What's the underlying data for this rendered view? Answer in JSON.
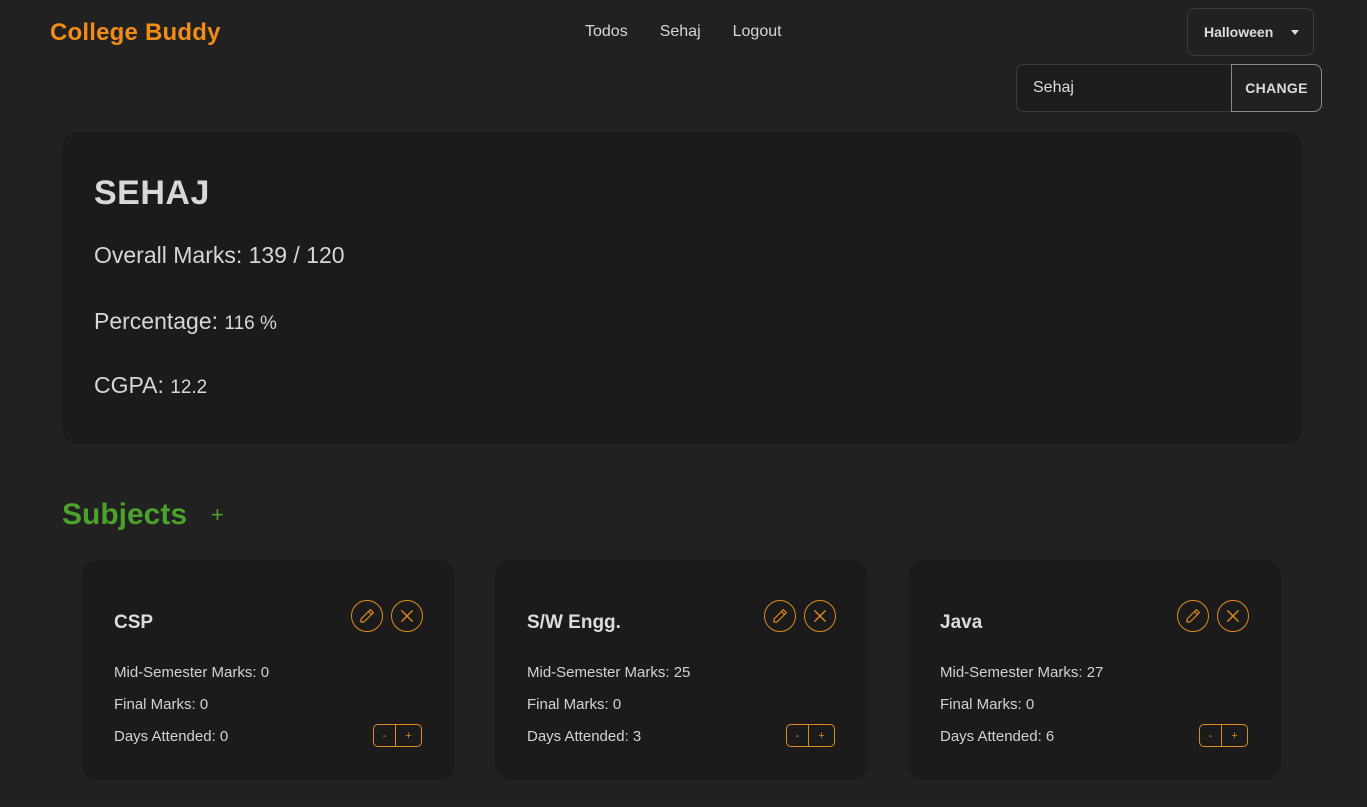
{
  "brand": "College Buddy",
  "nav": {
    "todos": "Todos",
    "user": "Sehaj",
    "logout": "Logout"
  },
  "theme": {
    "selected": "Halloween"
  },
  "name_form": {
    "value": "Sehaj",
    "button": "CHANGE"
  },
  "summary": {
    "name": "SEHAJ",
    "overall_label": "Overall Marks: ",
    "overall_value": "139 / 120",
    "percentage_label": "Percentage: ",
    "percentage_value": "116 %",
    "cgpa_label": "CGPA: ",
    "cgpa_value": "12.2"
  },
  "subjects": {
    "title": "Subjects",
    "add": "+",
    "cards": [
      {
        "name": "CSP",
        "mid": "Mid-Semester Marks: 0",
        "final": "Final Marks: 0",
        "days": "Days Attended: 0"
      },
      {
        "name": "S/W Engg.",
        "mid": "Mid-Semester Marks: 25",
        "final": "Final Marks: 0",
        "days": "Days Attended: 3"
      },
      {
        "name": "Java",
        "mid": "Mid-Semester Marks: 27",
        "final": "Final Marks: 0",
        "days": "Days Attended: 6"
      }
    ],
    "stepper": {
      "dec": "-",
      "inc": "+"
    }
  },
  "colors": {
    "accent": "#f28c18",
    "green": "#4ca12a",
    "background": "#212121",
    "card": "#1b1b1b"
  }
}
